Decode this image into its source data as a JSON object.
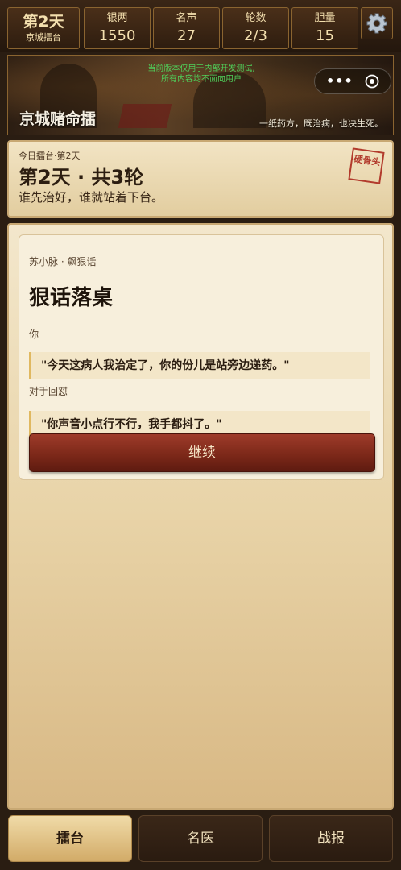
{
  "topbar": {
    "day": "第2天",
    "location": "京城擂台",
    "stats": [
      {
        "label": "银两",
        "value": "1550"
      },
      {
        "label": "名声",
        "value": "27"
      },
      {
        "label": "轮数",
        "value": "2/3"
      },
      {
        "label": "胆量",
        "value": "15"
      }
    ],
    "settings_icon": "gear-icon"
  },
  "banner": {
    "notice_line1": "当前版本仅用于内部开发测试,",
    "notice_line2": "所有内容均不面向用户",
    "title": "京城赌命擂",
    "tagline": "一纸药方，既治病，也决生死。",
    "capsule": {
      "more_icon": "more-dots-icon",
      "close_icon": "record-circle-icon"
    }
  },
  "day_card": {
    "subtitle": "今日擂台·第2天",
    "heading": "第2天 · 共3轮",
    "description": "谁先治好，谁就站着下台。",
    "stamp_text": "硬骨头"
  },
  "dialog": {
    "speaker_header": "苏小脉 · 飙狠话",
    "headline": "狠话落桌",
    "you_label": "你",
    "you_quote": "\"今天这病人我治定了，你的份儿是站旁边递药。\"",
    "rival_label": "对手回怼",
    "rival_quote": "\"你声音小点行不行，我手都抖了。\"",
    "continue_label": "继续"
  },
  "bottom_nav": {
    "tabs": [
      {
        "label": "擂台",
        "active": true
      },
      {
        "label": "名医",
        "active": false
      },
      {
        "label": "战报",
        "active": false
      }
    ]
  },
  "colors": {
    "accent_red": "#7a2718",
    "gold_border": "#8a6430",
    "notice_green": "#4fd05a",
    "stamp_red": "#b23a2c"
  }
}
